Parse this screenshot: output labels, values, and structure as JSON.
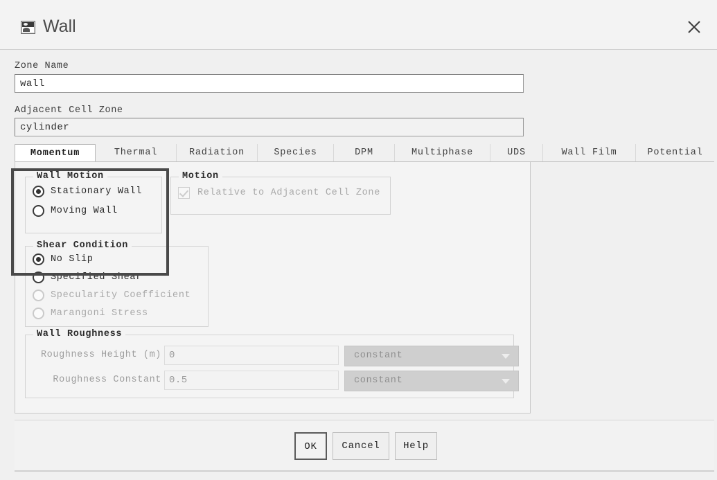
{
  "window": {
    "title": "Wall",
    "icon": "image-icon",
    "close_icon": "close-icon"
  },
  "form": {
    "zone_name_label": "Zone Name",
    "zone_name_value": "wall",
    "adjacent_cell_zone_label": "Adjacent Cell Zone",
    "adjacent_cell_zone_value": "cylinder"
  },
  "tabs": [
    {
      "label": "Momentum",
      "active": true
    },
    {
      "label": "Thermal",
      "active": false
    },
    {
      "label": "Radiation",
      "active": false
    },
    {
      "label": "Species",
      "active": false
    },
    {
      "label": "DPM",
      "active": false
    },
    {
      "label": "Multiphase",
      "active": false
    },
    {
      "label": "UDS",
      "active": false
    },
    {
      "label": "Wall Film",
      "active": false
    },
    {
      "label": "Potential",
      "active": false
    }
  ],
  "wall_motion": {
    "title": "Wall Motion",
    "options": [
      {
        "label": "Stationary Wall",
        "selected": true,
        "disabled": false
      },
      {
        "label": "Moving Wall",
        "selected": false,
        "disabled": false
      }
    ]
  },
  "motion": {
    "title": "Motion",
    "checkbox_label": "Relative to Adjacent Cell Zone",
    "checkbox_checked": true,
    "checkbox_disabled": true
  },
  "shear_condition": {
    "title": "Shear Condition",
    "options": [
      {
        "label": "No Slip",
        "selected": true,
        "disabled": false
      },
      {
        "label": "Specified Shear",
        "selected": false,
        "disabled": false
      },
      {
        "label": "Specularity Coefficient",
        "selected": false,
        "disabled": true
      },
      {
        "label": "Marangoni Stress",
        "selected": false,
        "disabled": true
      }
    ]
  },
  "wall_roughness": {
    "title": "Wall Roughness",
    "rows": [
      {
        "label": "Roughness Height (m)",
        "value": "0",
        "method": "constant"
      },
      {
        "label": "Roughness Constant",
        "value": "0.5",
        "method": "constant"
      }
    ]
  },
  "footer": {
    "ok_label": "OK",
    "cancel_label": "Cancel",
    "help_label": "Help"
  },
  "annotation": {
    "highlight_color": "#494949"
  }
}
